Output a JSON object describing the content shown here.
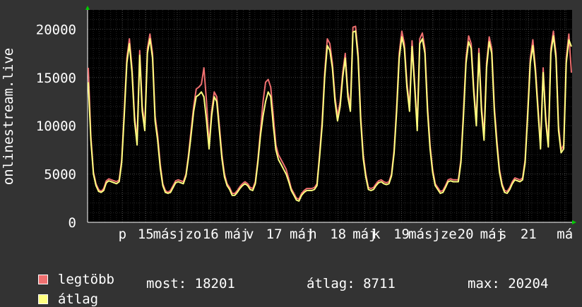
{
  "chart_data": {
    "type": "line",
    "ylabel": "onlinestream.live",
    "yticks": [
      0,
      5000,
      10000,
      15000,
      20000
    ],
    "ylim": [
      0,
      22000
    ],
    "grid": true,
    "x_ticks": [
      {
        "text": "p",
        "pos": 0.072
      },
      {
        "text": "15",
        "pos": 0.12
      },
      {
        "text": "másjzo",
        "pos": 0.185
      },
      {
        "text": "16",
        "pos": 0.254
      },
      {
        "text": "máj",
        "pos": 0.308
      },
      {
        "text": "v",
        "pos": 0.335
      },
      {
        "text": "17",
        "pos": 0.385
      },
      {
        "text": "máj",
        "pos": 0.442
      },
      {
        "text": "h",
        "pos": 0.465
      },
      {
        "text": "18",
        "pos": 0.517
      },
      {
        "text": "máj",
        "pos": 0.572
      },
      {
        "text": "k",
        "pos": 0.596
      },
      {
        "text": "19",
        "pos": 0.648
      },
      {
        "text": "másjze",
        "pos": 0.712
      },
      {
        "text": "20",
        "pos": 0.78
      },
      {
        "text": "máj",
        "pos": 0.835
      },
      {
        "text": "s",
        "pos": 0.857
      },
      {
        "text": "21",
        "pos": 0.91
      },
      {
        "text": "má",
        "pos": 0.985
      }
    ],
    "series": [
      {
        "name": "legtöbb",
        "color": "#f07070",
        "values": [
          16000,
          9000,
          5200,
          4000,
          3400,
          3200,
          3500,
          4300,
          4500,
          4400,
          4300,
          4200,
          4400,
          6500,
          11500,
          17000,
          19000,
          16000,
          11000,
          8500,
          17800,
          12000,
          10000,
          18000,
          19500,
          17500,
          11000,
          9000,
          6000,
          4000,
          3300,
          3100,
          3300,
          3800,
          4300,
          4400,
          4300,
          4200,
          5000,
          7000,
          9500,
          12000,
          13800,
          14000,
          14300,
          16000,
          12500,
          8000,
          11500,
          13500,
          13000,
          10000,
          7000,
          5000,
          4000,
          3600,
          3000,
          3000,
          3300,
          3700,
          4000,
          4200,
          4000,
          3600,
          3500,
          4200,
          6500,
          9500,
          12500,
          14500,
          14800,
          14000,
          11000,
          8000,
          7000,
          6500,
          6000,
          5500,
          4500,
          3500,
          3000,
          2500,
          2400,
          3000,
          3300,
          3500,
          3500,
          3500,
          3600,
          4000,
          7000,
          10500,
          15500,
          19000,
          18500,
          16500,
          13000,
          11000,
          12500,
          15500,
          17500,
          13500,
          12000,
          20200,
          20300,
          17500,
          11000,
          7000,
          5000,
          3600,
          3500,
          3600,
          4000,
          4300,
          4400,
          4200,
          4100,
          4200,
          5000,
          7500,
          12000,
          17500,
          19800,
          18500,
          14500,
          12000,
          18800,
          14500,
          10000,
          19000,
          19600,
          18000,
          12000,
          8000,
          5500,
          4000,
          3600,
          3200,
          3300,
          3800,
          4400,
          4500,
          4400,
          4400,
          4400,
          6500,
          11500,
          17000,
          19300,
          18500,
          14000,
          10500,
          18000,
          12000,
          9000,
          16500,
          19200,
          18000,
          12000,
          8500,
          5500,
          4000,
          3300,
          3200,
          3600,
          4200,
          4600,
          4500,
          4400,
          4600,
          6500,
          11500,
          17000,
          18900,
          16000,
          12000,
          8000,
          16000,
          11000,
          8200,
          18000,
          19800,
          17500,
          10000,
          7500,
          8000,
          17000,
          19500,
          15500
        ]
      },
      {
        "name": "átlag",
        "color": "#ffff80",
        "values": [
          14500,
          8500,
          5000,
          3800,
          3200,
          3100,
          3300,
          4100,
          4300,
          4200,
          4100,
          4000,
          4200,
          6200,
          11000,
          16500,
          18500,
          15500,
          10500,
          8000,
          17300,
          11500,
          9500,
          17500,
          19000,
          17000,
          10500,
          8500,
          5600,
          3800,
          3100,
          3000,
          3100,
          3600,
          4100,
          4200,
          4100,
          4000,
          4800,
          6700,
          9000,
          11500,
          13000,
          13200,
          13500,
          13000,
          10500,
          7600,
          11000,
          13000,
          12500,
          9500,
          6600,
          4700,
          3800,
          3400,
          2800,
          2800,
          3100,
          3500,
          3800,
          4000,
          3800,
          3400,
          3300,
          4000,
          6200,
          9000,
          11000,
          12500,
          13500,
          13000,
          10000,
          7500,
          6500,
          6000,
          5500,
          5000,
          4200,
          3300,
          2800,
          2300,
          2200,
          2800,
          3100,
          3300,
          3300,
          3300,
          3400,
          3800,
          6700,
          10000,
          15000,
          18300,
          17800,
          16000,
          12500,
          10500,
          12000,
          15000,
          17000,
          13000,
          11500,
          19700,
          19800,
          17000,
          10500,
          6600,
          4700,
          3400,
          3300,
          3400,
          3800,
          4100,
          4200,
          4000,
          3900,
          4000,
          4800,
          7200,
          11500,
          17000,
          19200,
          18000,
          14000,
          11500,
          18200,
          14000,
          9500,
          18500,
          19000,
          17500,
          11500,
          7600,
          5200,
          3800,
          3400,
          3000,
          3100,
          3600,
          4200,
          4300,
          4200,
          4200,
          4200,
          6200,
          11000,
          16500,
          18700,
          18000,
          13500,
          10000,
          17500,
          11500,
          8500,
          16000,
          18700,
          17500,
          11500,
          8000,
          5200,
          3800,
          3100,
          3000,
          3400,
          4000,
          4400,
          4300,
          4200,
          4400,
          6200,
          11000,
          16500,
          18300,
          15500,
          11500,
          7600,
          15500,
          10500,
          7800,
          17500,
          19300,
          17000,
          9500,
          7200,
          7600,
          16500,
          18900,
          18201
        ]
      }
    ]
  },
  "legend": {
    "max_label": "legtöbb",
    "avg_label": "átlag"
  },
  "stats": {
    "now": "most: 18201",
    "avg": "átlag: 8711",
    "max": "max: 20204"
  },
  "colors": {
    "background": "#333333",
    "plot_bg": "#000000",
    "grid_major": "#444444",
    "grid_minor": "#262626",
    "axis": "#ffffff",
    "arrow": "#00cc00"
  }
}
